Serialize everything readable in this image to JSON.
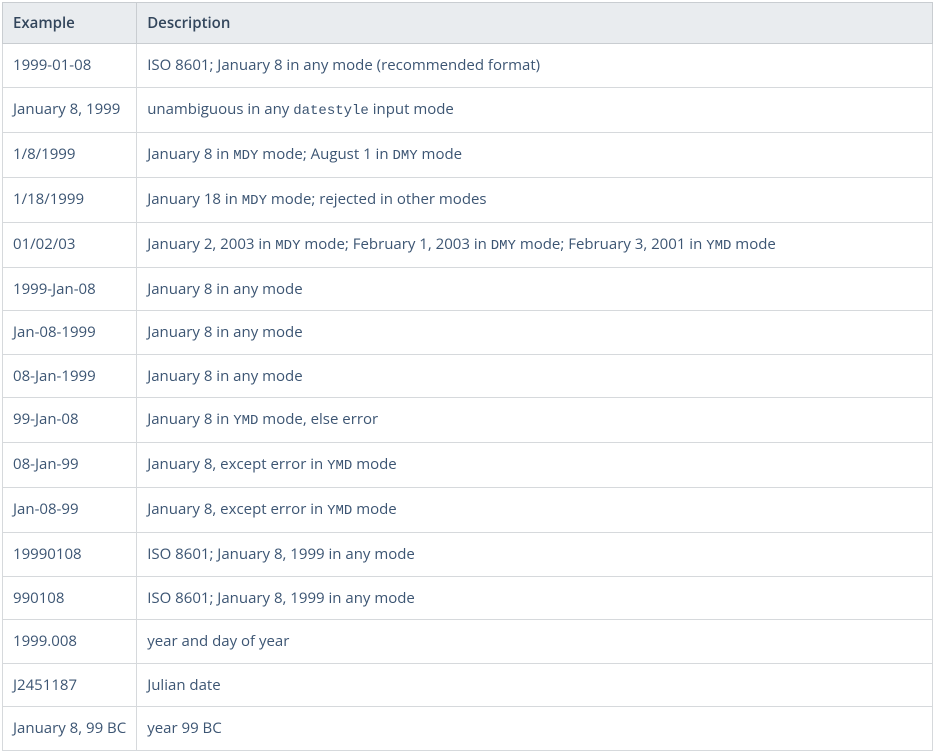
{
  "table": {
    "headers": {
      "example": "Example",
      "description": "Description"
    },
    "rows": [
      {
        "example": "1999-01-08",
        "description": [
          {
            "t": "text",
            "v": "ISO 8601; January 8 in any mode (recommended format)"
          }
        ]
      },
      {
        "example": "January 8, 1999",
        "description": [
          {
            "t": "text",
            "v": "unambiguous in any "
          },
          {
            "t": "code",
            "v": "datestyle"
          },
          {
            "t": "text",
            "v": " input mode"
          }
        ]
      },
      {
        "example": "1/8/1999",
        "description": [
          {
            "t": "text",
            "v": "January 8 in "
          },
          {
            "t": "code",
            "v": "MDY"
          },
          {
            "t": "text",
            "v": " mode; August 1 in "
          },
          {
            "t": "code",
            "v": "DMY"
          },
          {
            "t": "text",
            "v": " mode"
          }
        ]
      },
      {
        "example": "1/18/1999",
        "description": [
          {
            "t": "text",
            "v": "January 18 in "
          },
          {
            "t": "code",
            "v": "MDY"
          },
          {
            "t": "text",
            "v": " mode; rejected in other modes"
          }
        ]
      },
      {
        "example": "01/02/03",
        "description": [
          {
            "t": "text",
            "v": "January 2, 2003 in "
          },
          {
            "t": "code",
            "v": "MDY"
          },
          {
            "t": "text",
            "v": " mode; February 1, 2003 in "
          },
          {
            "t": "code",
            "v": "DMY"
          },
          {
            "t": "text",
            "v": " mode; February 3, 2001 in "
          },
          {
            "t": "code",
            "v": "YMD"
          },
          {
            "t": "text",
            "v": " mode"
          }
        ]
      },
      {
        "example": "1999-Jan-08",
        "description": [
          {
            "t": "text",
            "v": "January 8 in any mode"
          }
        ]
      },
      {
        "example": "Jan-08-1999",
        "description": [
          {
            "t": "text",
            "v": "January 8 in any mode"
          }
        ]
      },
      {
        "example": "08-Jan-1999",
        "description": [
          {
            "t": "text",
            "v": "January 8 in any mode"
          }
        ]
      },
      {
        "example": "99-Jan-08",
        "description": [
          {
            "t": "text",
            "v": "January 8 in "
          },
          {
            "t": "code",
            "v": "YMD"
          },
          {
            "t": "text",
            "v": " mode, else error"
          }
        ]
      },
      {
        "example": "08-Jan-99",
        "description": [
          {
            "t": "text",
            "v": "January 8, except error in "
          },
          {
            "t": "code",
            "v": "YMD"
          },
          {
            "t": "text",
            "v": " mode"
          }
        ]
      },
      {
        "example": "Jan-08-99",
        "description": [
          {
            "t": "text",
            "v": "January 8, except error in "
          },
          {
            "t": "code",
            "v": "YMD"
          },
          {
            "t": "text",
            "v": " mode"
          }
        ]
      },
      {
        "example": "19990108",
        "description": [
          {
            "t": "text",
            "v": "ISO 8601; January 8, 1999 in any mode"
          }
        ]
      },
      {
        "example": "990108",
        "description": [
          {
            "t": "text",
            "v": "ISO 8601; January 8, 1999 in any mode"
          }
        ]
      },
      {
        "example": "1999.008",
        "description": [
          {
            "t": "text",
            "v": "year and day of year"
          }
        ]
      },
      {
        "example": "J2451187",
        "description": [
          {
            "t": "text",
            "v": "Julian date"
          }
        ]
      },
      {
        "example": "January 8, 99 BC",
        "description": [
          {
            "t": "text",
            "v": "year 99 BC"
          }
        ]
      }
    ]
  }
}
